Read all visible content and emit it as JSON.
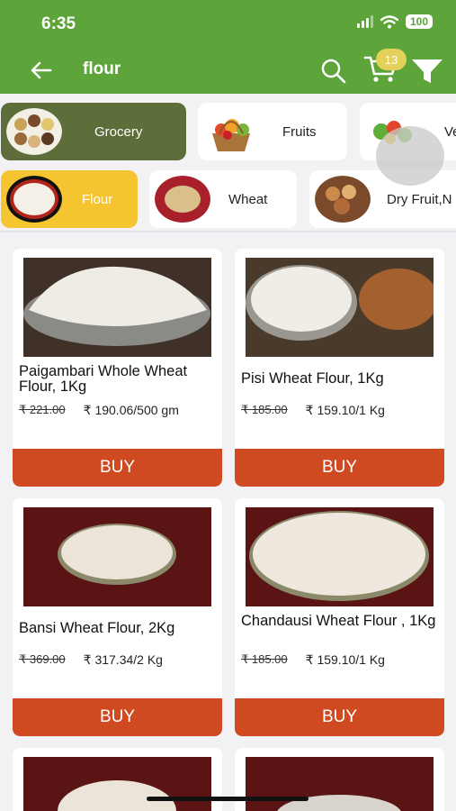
{
  "status_bar": {
    "time": "6:35",
    "battery": "100"
  },
  "header": {
    "search_query": "flour",
    "cart_count": "13",
    "icons": {
      "back": "arrow-left-icon",
      "search": "search-icon",
      "cart": "cart-icon",
      "filter": "filter-icon"
    }
  },
  "categories": [
    {
      "label": "Grocery",
      "selected": true
    },
    {
      "label": "Fruits",
      "selected": false
    },
    {
      "label": "Ve",
      "selected": false
    }
  ],
  "subcategories": [
    {
      "label": "Flour",
      "selected": true
    },
    {
      "label": "Wheat",
      "selected": false
    },
    {
      "label": "Dry Fruit,N",
      "selected": false
    }
  ],
  "products": [
    {
      "name": "Paigambari Whole Wheat Flour, 1Kg",
      "mrp": "₹ 221.00",
      "price": "₹ 190.06/500 gm",
      "buy": "BUY"
    },
    {
      "name": "Pisi Wheat Flour, 1Kg",
      "mrp": "₹ 185.00",
      "price": "₹ 159.10/1 Kg",
      "buy": "BUY"
    },
    {
      "name": "Bansi Wheat Flour, 2Kg",
      "mrp": "₹ 369.00",
      "price": "₹ 317.34/2 Kg",
      "buy": "BUY"
    },
    {
      "name": "Chandausi Wheat Flour , 1Kg",
      "mrp": "₹ 185.00",
      "price": "₹ 159.10/1 Kg",
      "buy": "BUY"
    }
  ],
  "colors": {
    "header": "#5da53a",
    "buy": "#cf4a20",
    "flour_chip": "#f5c431",
    "grocery_chip": "#5e6e3a",
    "cart_badge": "#e4d15a"
  }
}
